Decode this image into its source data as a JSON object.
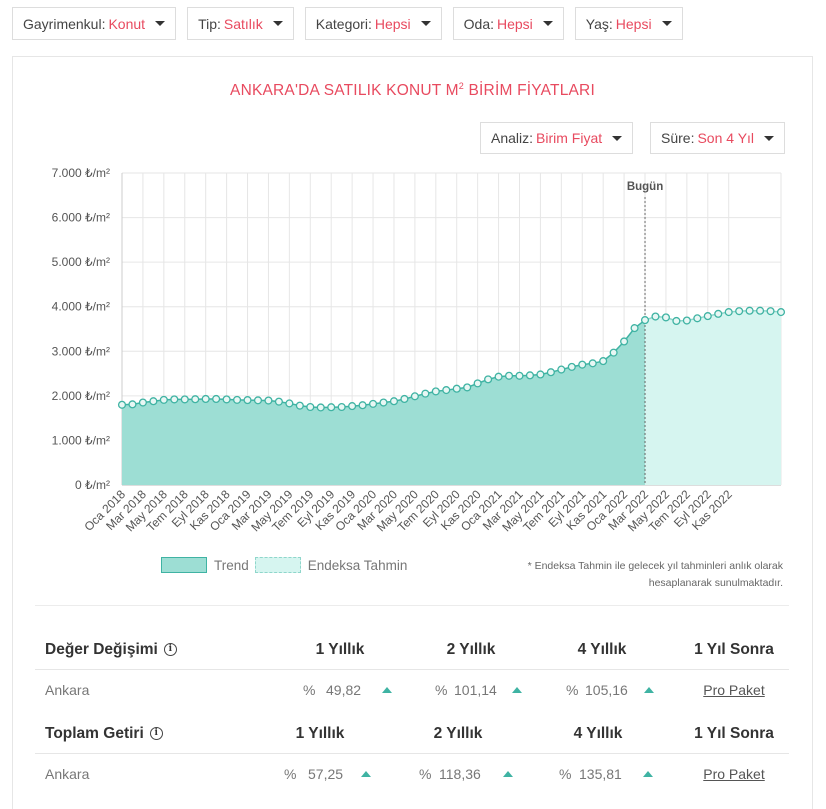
{
  "filters": [
    {
      "label": "Gayrimenkul:",
      "value": "Konut"
    },
    {
      "label": "Tip:",
      "value": "Satılık"
    },
    {
      "label": "Kategori:",
      "value": "Hepsi"
    },
    {
      "label": "Oda:",
      "value": "Hepsi"
    },
    {
      "label": "Yaş:",
      "value": "Hepsi"
    }
  ],
  "title": "ANKARA'DA SATILIK KONUT M",
  "title_sup": "2",
  "title_suffix": " BİRİM FİYATLARI",
  "controls": {
    "analiz_label": "Analiz:",
    "analiz_value": "Birim Fiyat",
    "sure_label": "Süre:",
    "sure_value": "Son 4 Yıl"
  },
  "legend": {
    "trend": "Trend",
    "estimate": "Endeksa Tahmin"
  },
  "note": "* Endeksa Tahmin ile gelecek yıl tahminleri anlık olarak hesaplanarak sunulmaktadır.",
  "chart_data": {
    "type": "area",
    "y_tick_labels": [
      "0 ₺/m²",
      "1.000 ₺/m²",
      "2.000 ₺/m²",
      "3.000 ₺/m²",
      "4.000 ₺/m²",
      "5.000 ₺/m²",
      "6.000 ₺/m²",
      "7.000 ₺/m²"
    ],
    "ylim": [
      0,
      7000
    ],
    "x_tick_labels": [
      "Oca 2018",
      "Mar 2018",
      "May 2018",
      "Tem 2018",
      "Eyl 2018",
      "Kas 2018",
      "Oca 2019",
      "Mar 2019",
      "May 2019",
      "Tem 2019",
      "Eyl 2019",
      "Kas 2019",
      "Oca 2020",
      "Mar 2020",
      "May 2020",
      "Tem 2020",
      "Eyl 2020",
      "Kas 2020",
      "Oca 2021",
      "Mar 2021",
      "May 2021",
      "Tem 2021",
      "Eyl 2021",
      "Kas 2021",
      "Oca 2022",
      "Mar 2022",
      "May 2022",
      "Tem 2022",
      "Eyl 2022",
      "Kas 2022"
    ],
    "today_label": "Bugün",
    "grid": true,
    "series": [
      {
        "name": "Trend",
        "values": [
          1800,
          1810,
          1850,
          1880,
          1910,
          1920,
          1920,
          1925,
          1930,
          1930,
          1920,
          1910,
          1905,
          1900,
          1895,
          1870,
          1830,
          1780,
          1750,
          1740,
          1745,
          1750,
          1770,
          1790,
          1820,
          1850,
          1880,
          1930,
          1990,
          2050,
          2100,
          2130,
          2160,
          2190,
          2280,
          2370,
          2430,
          2450,
          2450,
          2460,
          2480,
          2530,
          2590,
          2650,
          2700,
          2730,
          2780,
          2970,
          3220,
          3520,
          3700
        ]
      },
      {
        "name": "Endeksa Tahmin",
        "values": [
          3780,
          3760,
          3680,
          3690,
          3740,
          3790,
          3840,
          3880,
          3900,
          3910,
          3910,
          3900,
          3880
        ]
      }
    ]
  },
  "table": {
    "value_change": {
      "title": "Değer Değişimi",
      "cols": [
        "1 Yıllık",
        "2 Yıllık",
        "4 Yıllık",
        "1 Yıl Sonra"
      ],
      "row_label": "Ankara",
      "values": [
        "49,82",
        "101,14",
        "105,16"
      ],
      "pct": "%",
      "link": "Pro Paket"
    },
    "total_return": {
      "title": "Toplam Getiri",
      "cols": [
        "1 Yıllık",
        "2 Yıllık",
        "4 Yıllık",
        "1 Yıl Sonra"
      ],
      "row_label": "Ankara",
      "values": [
        "57,25",
        "118,36",
        "135,81"
      ],
      "pct": "%",
      "link": "Pro Paket"
    }
  },
  "colors": {
    "accent": "#e84a5f",
    "trend_fill": "#9dded4",
    "trend_line": "#3fb3a3",
    "estimate_fill": "#d6f5f0"
  }
}
